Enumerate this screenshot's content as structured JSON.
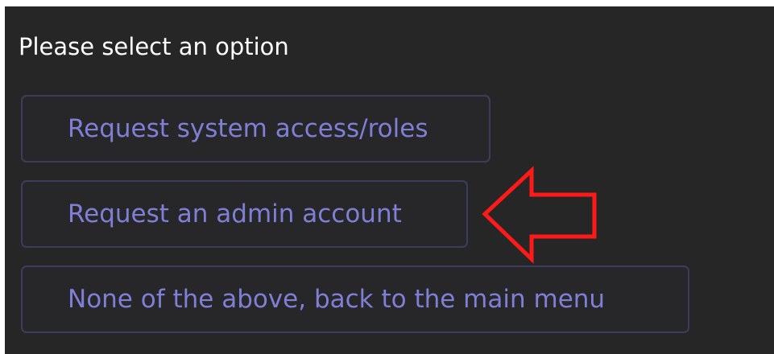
{
  "prompt": {
    "text": "Please select an option"
  },
  "options": [
    {
      "label": "Request system access/roles"
    },
    {
      "label": "Request an admin account"
    },
    {
      "label": "None of the above, back to the main menu"
    }
  ],
  "annotation": {
    "icon": "arrow-left-icon",
    "color": "#ff1a1a"
  },
  "colors": {
    "background": "#262626",
    "option_text": "#7f7fd6",
    "option_border": "#3e3c5c",
    "prompt_text": "#ffffff"
  }
}
